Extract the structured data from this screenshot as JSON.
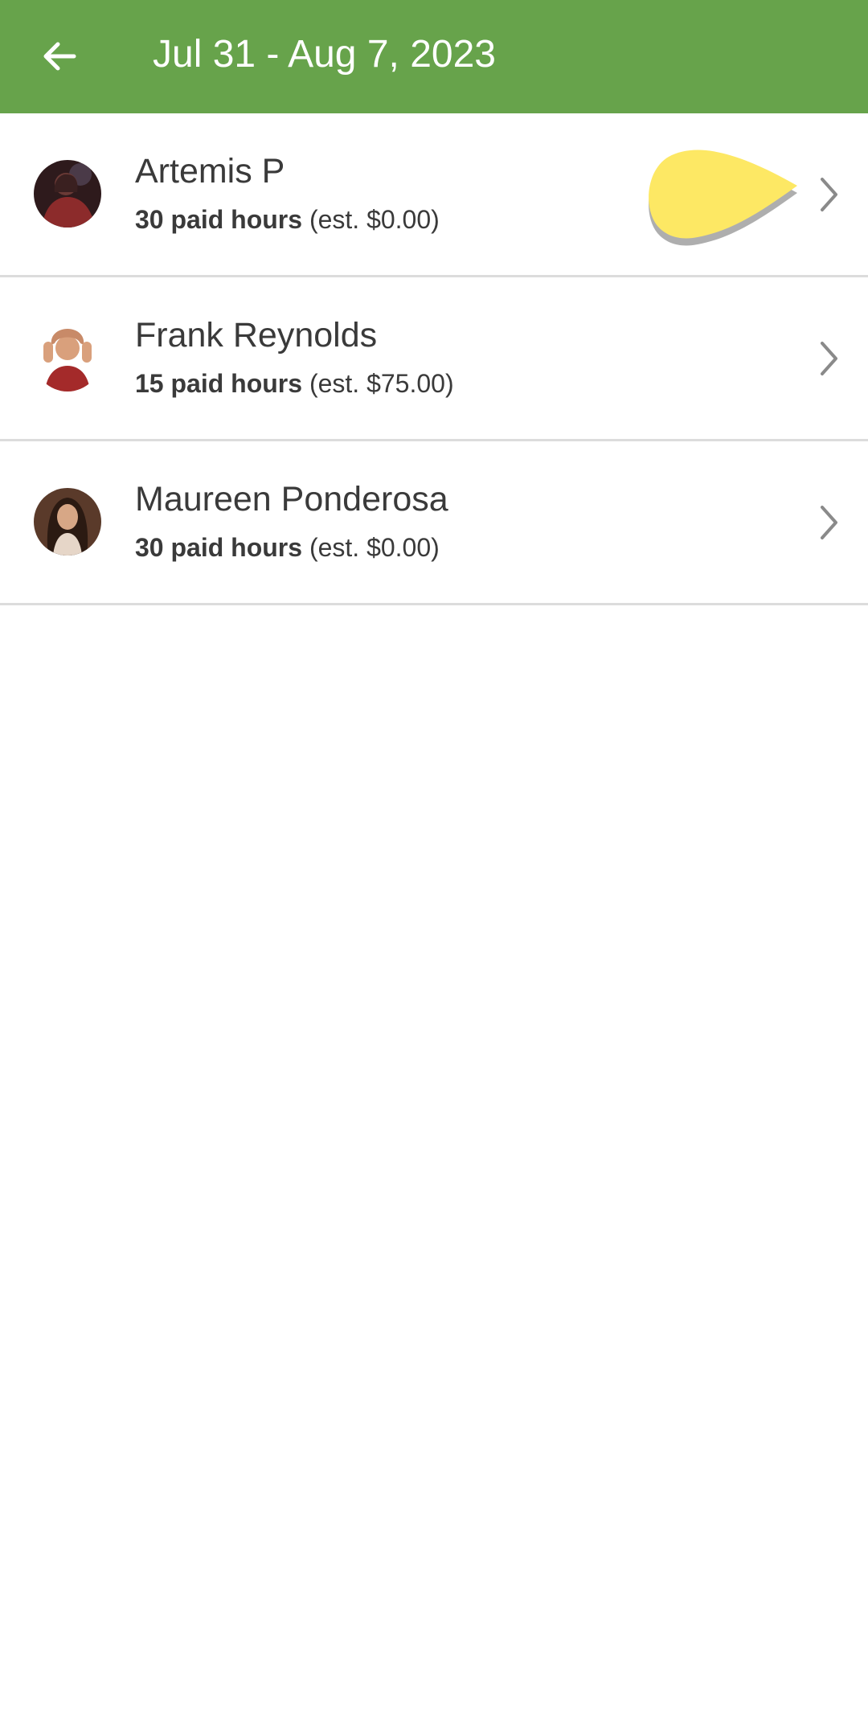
{
  "app_bar": {
    "title": "Jul 31 - Aug 7, 2023",
    "back_icon": "arrow-left-icon",
    "background": "#67a34b"
  },
  "employees": [
    {
      "name": "Artemis P",
      "hours": "30 paid hours",
      "estimate": "(est. $0.00)"
    },
    {
      "name": "Frank Reynolds",
      "hours": "15 paid hours",
      "estimate": "(est. $75.00)"
    },
    {
      "name": "Maureen Ponderosa",
      "hours": "30 paid hours",
      "estimate": "(est. $0.00)"
    }
  ],
  "row_icon": "chevron-right-icon",
  "highlight_color": "#fde864"
}
